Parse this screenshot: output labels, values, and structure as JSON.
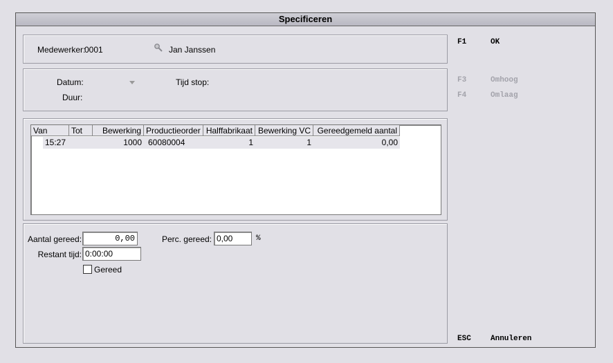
{
  "window": {
    "title": "Specificeren"
  },
  "employee": {
    "label": "Medewerker:",
    "code": "0001",
    "name": "Jan Janssen"
  },
  "time_panel": {
    "datum_label": "Datum:",
    "tijd_stop_label": "Tijd stop:",
    "duur_label": "Duur:"
  },
  "table": {
    "columns": [
      "Van",
      "Tot",
      "Bewerking",
      "Productieorder",
      "Halffabrikaat",
      "Bewerking VC",
      "Gereedgemeld aantal"
    ],
    "rows": [
      {
        "van": "15:27",
        "tot": "",
        "bewerking": "1000",
        "productieorder": "60080004",
        "halffabrikaat": "1",
        "bewerking_vc": "1",
        "gereedgemeld_aantal": "0,00"
      }
    ]
  },
  "form": {
    "aantal_gereed_label": "Aantal gereed:",
    "aantal_gereed_value": "0,00",
    "perc_gereed_label": "Perc. gereed:",
    "perc_gereed_value": "0,00",
    "perc_unit": "%",
    "restant_tijd_label": "Restant tijd:",
    "restant_tijd_value": "0:00:00",
    "gereed_label": "Gereed"
  },
  "keys": [
    {
      "key": "F1",
      "label": "OK"
    },
    {
      "key": "F3",
      "label": "Omhoog"
    },
    {
      "key": "F4",
      "label": "Omlaag"
    },
    {
      "key": "ESC",
      "label": "Annuleren"
    }
  ]
}
